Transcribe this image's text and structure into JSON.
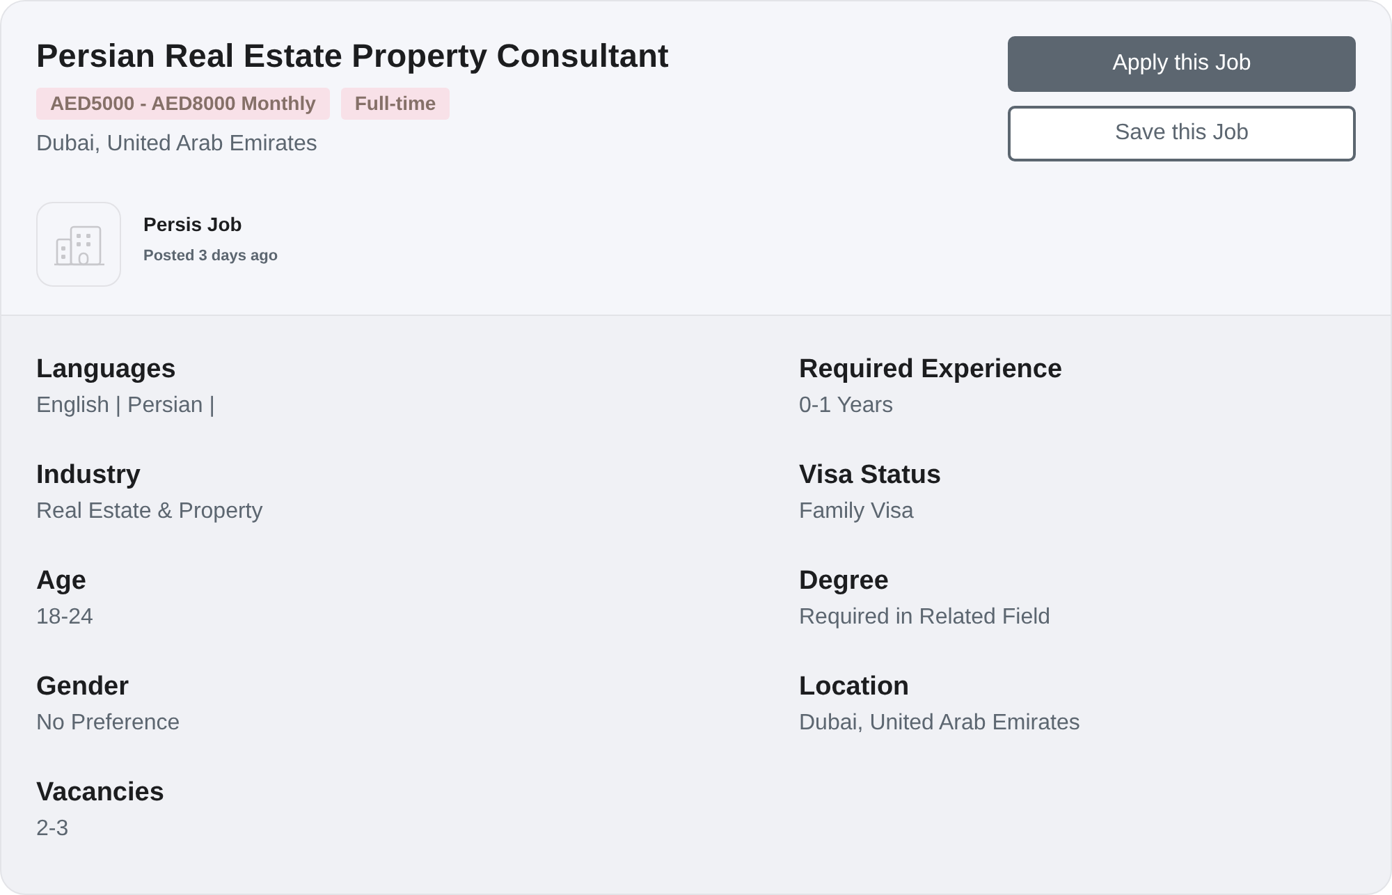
{
  "job": {
    "title": "Persian Real Estate Property Consultant",
    "tags": [
      "AED5000 - AED8000 Monthly",
      "Full-time"
    ],
    "location": "Dubai, United Arab Emirates",
    "company": {
      "name": "Persis Job",
      "posted": "Posted 3 days ago"
    },
    "actions": [
      {
        "label": "Apply this Job",
        "kind": "primary"
      },
      {
        "label": "Save this Job",
        "kind": "outline"
      }
    ]
  },
  "details": [
    {
      "label": "Languages",
      "value": "English | Persian |"
    },
    {
      "label": "Required Experience",
      "value": "0-1 Years"
    },
    {
      "label": "Industry",
      "value": "Real Estate & Property"
    },
    {
      "label": "Visa Status",
      "value": "Family Visa"
    },
    {
      "label": "Age",
      "value": "18-24"
    },
    {
      "label": "Degree",
      "value": "Required in Related Field"
    },
    {
      "label": "Gender",
      "value": "No Preference"
    },
    {
      "label": "Location",
      "value": "Dubai, United Arab Emirates"
    },
    {
      "label": "Vacancies",
      "value": "2-3"
    }
  ]
}
